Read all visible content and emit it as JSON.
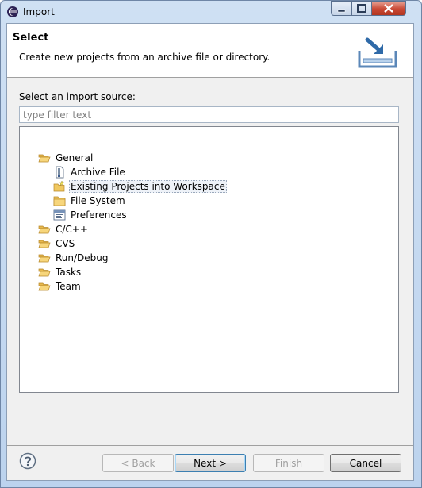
{
  "window": {
    "title": "Import"
  },
  "header": {
    "title": "Select",
    "description": "Create new projects from an archive file or directory."
  },
  "source": {
    "label": "Select an import source:",
    "filter_placeholder": "type filter text",
    "filter_value": ""
  },
  "tree": [
    {
      "label": "General",
      "icon": "folder-open-icon",
      "expanded": true
    },
    {
      "label": "Archive File",
      "icon": "archive-file-icon"
    },
    {
      "label": "Existing Projects into Workspace",
      "icon": "existing-projects-icon",
      "selected": true
    },
    {
      "label": "File System",
      "icon": "folder-icon"
    },
    {
      "label": "Preferences",
      "icon": "preferences-icon"
    },
    {
      "label": "C/C++",
      "icon": "folder-closed-icon",
      "expanded": false
    },
    {
      "label": "CVS",
      "icon": "folder-closed-icon",
      "expanded": false
    },
    {
      "label": "Run/Debug",
      "icon": "folder-closed-icon",
      "expanded": false
    },
    {
      "label": "Tasks",
      "icon": "folder-closed-icon",
      "expanded": false
    },
    {
      "label": "Team",
      "icon": "folder-closed-icon",
      "expanded": false
    }
  ],
  "buttons": {
    "back": "< Back",
    "next": "Next >",
    "finish": "Finish",
    "cancel": "Cancel"
  },
  "colors": {
    "selection_border": "#9aa8bb",
    "folder": "#f0c860",
    "default_button_border": "#3c7fb1"
  }
}
